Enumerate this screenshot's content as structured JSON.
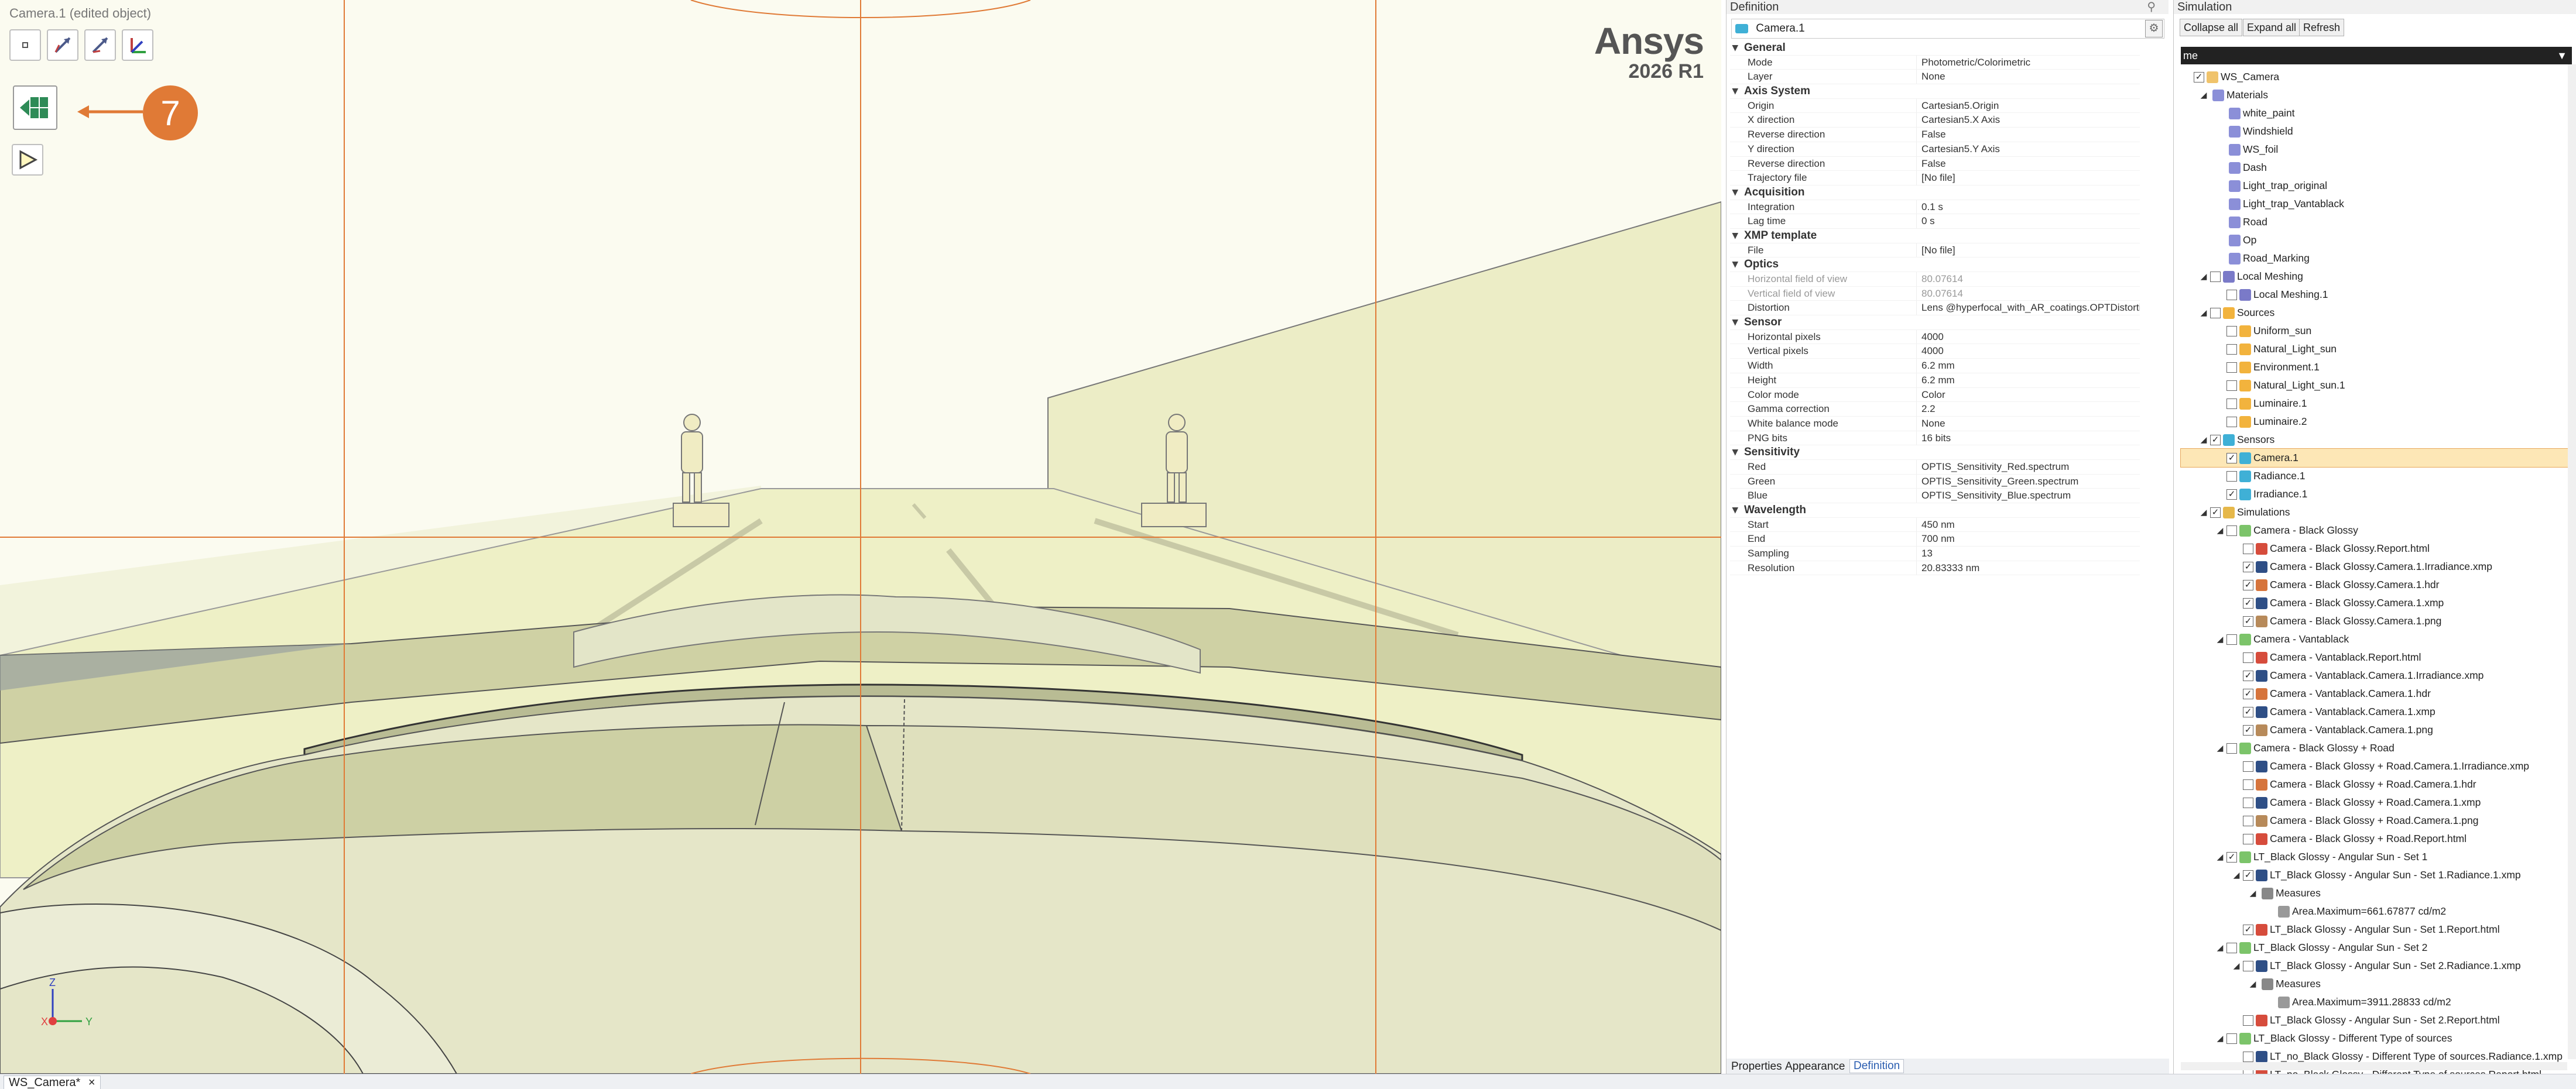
{
  "viewport": {
    "title": "Camera.1 (edited object)",
    "logo_name": "Ansys",
    "logo_version": "2026 R1",
    "callout_number": "7",
    "axis_labels": {
      "z": "Z",
      "x": "X",
      "y": "Y"
    }
  },
  "toolbar_icons": [
    "origin-point-icon",
    "axis-arrow-icon",
    "axis-arrow-2-icon",
    "axis-system-icon",
    "camera-preview-icon",
    "run-play-icon"
  ],
  "bottom_tab": "WS_Camera*",
  "definition": {
    "header": "Definition",
    "object_name": "Camera.1",
    "categories": [
      {
        "name": "General",
        "rows": [
          {
            "n": "Mode",
            "v": "Photometric/Colorimetric"
          },
          {
            "n": "Layer",
            "v": "None"
          }
        ]
      },
      {
        "name": "Axis System",
        "rows": [
          {
            "n": "Origin",
            "v": "Cartesian5.Origin"
          },
          {
            "n": "X direction",
            "v": "Cartesian5.X Axis"
          },
          {
            "n": "Reverse direction",
            "v": "False"
          },
          {
            "n": "Y direction",
            "v": "Cartesian5.Y Axis"
          },
          {
            "n": "Reverse direction",
            "v": "False"
          },
          {
            "n": "Trajectory file",
            "v": "[No file]"
          }
        ]
      },
      {
        "name": "Acquisition",
        "rows": [
          {
            "n": "Integration",
            "v": "0.1 s"
          },
          {
            "n": "Lag time",
            "v": "0 s"
          }
        ]
      },
      {
        "name": "XMP template",
        "rows": [
          {
            "n": "File",
            "v": "[No file]"
          }
        ]
      },
      {
        "name": "Optics",
        "rows": [
          {
            "n": "Horizontal field of view",
            "v": "80.07614",
            "ro": true
          },
          {
            "n": "Vertical field of view",
            "v": "80.07614",
            "ro": true
          },
          {
            "n": "Distortion",
            "v": "Lens @hyperfocal_with_AR_coatings.OPTDistortion"
          }
        ]
      },
      {
        "name": "Sensor",
        "rows": [
          {
            "n": "Horizontal pixels",
            "v": "4000"
          },
          {
            "n": "Vertical pixels",
            "v": "4000"
          },
          {
            "n": "Width",
            "v": "6.2 mm"
          },
          {
            "n": "Height",
            "v": "6.2 mm"
          },
          {
            "n": "Color mode",
            "v": "Color"
          },
          {
            "n": "Gamma correction",
            "v": "2.2"
          },
          {
            "n": "White balance mode",
            "v": "None"
          },
          {
            "n": "PNG bits",
            "v": "16 bits"
          }
        ]
      },
      {
        "name": "Sensitivity",
        "rows": [
          {
            "n": "Red",
            "v": "OPTIS_Sensitivity_Red.spectrum"
          },
          {
            "n": "Green",
            "v": "OPTIS_Sensitivity_Green.spectrum"
          },
          {
            "n": "Blue",
            "v": "OPTIS_Sensitivity_Blue.spectrum"
          }
        ]
      },
      {
        "name": "Wavelength",
        "rows": [
          {
            "n": "Start",
            "v": "450 nm"
          },
          {
            "n": "End",
            "v": "700 nm"
          },
          {
            "n": "Sampling",
            "v": "13"
          },
          {
            "n": "Resolution",
            "v": "20.83333 nm"
          }
        ]
      }
    ],
    "bottom_tabs": [
      "Properties",
      "Appearance",
      "Definition"
    ]
  },
  "simulation": {
    "header": "Simulation",
    "buttons": [
      "Collapse all",
      "Expand all",
      "Refresh"
    ],
    "column_header": "me",
    "tree": [
      {
        "d": 0,
        "t": "WS_Camera",
        "tog": "",
        "cb": "checked",
        "ic": "#f0c36b"
      },
      {
        "d": 1,
        "t": "Materials",
        "tog": "◢",
        "cb": "none",
        "ic": "#8b8fd8"
      },
      {
        "d": 2,
        "t": "white_paint",
        "tog": "",
        "cb": "none",
        "ic": "#8b8fd8"
      },
      {
        "d": 2,
        "t": "Windshield",
        "tog": "",
        "cb": "none",
        "ic": "#8b8fd8"
      },
      {
        "d": 2,
        "t": "WS_foil",
        "tog": "",
        "cb": "none",
        "ic": "#8b8fd8"
      },
      {
        "d": 2,
        "t": "Dash",
        "tog": "",
        "cb": "none",
        "ic": "#8b8fd8"
      },
      {
        "d": 2,
        "t": "Light_trap_original",
        "tog": "",
        "cb": "none",
        "ic": "#8b8fd8"
      },
      {
        "d": 2,
        "t": "Light_trap_Vantablack",
        "tog": "",
        "cb": "none",
        "ic": "#8b8fd8"
      },
      {
        "d": 2,
        "t": "Road",
        "tog": "",
        "cb": "none",
        "ic": "#8b8fd8"
      },
      {
        "d": 2,
        "t": "Op",
        "tog": "",
        "cb": "none",
        "ic": "#8b8fd8"
      },
      {
        "d": 2,
        "t": "Road_Marking",
        "tog": "",
        "cb": "none",
        "ic": "#8b8fd8"
      },
      {
        "d": 1,
        "t": "Local Meshing",
        "tog": "◢",
        "cb": "empty",
        "ic": "#7a7ac8"
      },
      {
        "d": 2,
        "t": "Local Meshing.1",
        "tog": "",
        "cb": "empty",
        "ic": "#7a7ac8"
      },
      {
        "d": 1,
        "t": "Sources",
        "tog": "◢",
        "cb": "empty",
        "ic": "#f2b33d"
      },
      {
        "d": 2,
        "t": "Uniform_sun",
        "tog": "",
        "cb": "empty",
        "ic": "#f2b33d"
      },
      {
        "d": 2,
        "t": "Natural_Light_sun",
        "tog": "",
        "cb": "empty",
        "ic": "#f2b33d"
      },
      {
        "d": 2,
        "t": "Environment.1",
        "tog": "",
        "cb": "empty",
        "ic": "#f2b33d"
      },
      {
        "d": 2,
        "t": "Natural_Light_sun.1",
        "tog": "",
        "cb": "empty",
        "ic": "#f2b33d"
      },
      {
        "d": 2,
        "t": "Luminaire.1",
        "tog": "",
        "cb": "empty",
        "ic": "#f2b33d"
      },
      {
        "d": 2,
        "t": "Luminaire.2",
        "tog": "",
        "cb": "empty",
        "ic": "#f2b33d"
      },
      {
        "d": 1,
        "t": "Sensors",
        "tog": "◢",
        "cb": "checked",
        "ic": "#3fb0d6"
      },
      {
        "d": 2,
        "t": "Camera.1",
        "tog": "",
        "cb": "checked",
        "ic": "#3fb0d6",
        "sel": true
      },
      {
        "d": 2,
        "t": "Radiance.1",
        "tog": "",
        "cb": "empty",
        "ic": "#3fb0d6"
      },
      {
        "d": 2,
        "t": "Irradiance.1",
        "tog": "",
        "cb": "checked",
        "ic": "#3fb0d6"
      },
      {
        "d": 1,
        "t": "Simulations",
        "tog": "◢",
        "cb": "checked",
        "ic": "#e6b84a"
      },
      {
        "d": 2,
        "t": "Camera -  Black Glossy",
        "tog": "◢",
        "cb": "empty",
        "ic": "#7cc46a"
      },
      {
        "d": 3,
        "t": "Camera -  Black Glossy.Report.html",
        "tog": "",
        "cb": "empty",
        "ic": "#d64c3c"
      },
      {
        "d": 3,
        "t": "Camera -  Black Glossy.Camera.1.Irradiance.xmp",
        "tog": "",
        "cb": "checked",
        "ic": "#2f4f86"
      },
      {
        "d": 3,
        "t": "Camera -  Black Glossy.Camera.1.hdr",
        "tog": "",
        "cb": "checked",
        "ic": "#d6743c"
      },
      {
        "d": 3,
        "t": "Camera -  Black Glossy.Camera.1.xmp",
        "tog": "",
        "cb": "checked",
        "ic": "#2f4f86"
      },
      {
        "d": 3,
        "t": "Camera -  Black Glossy.Camera.1.png",
        "tog": "",
        "cb": "checked",
        "ic": "#b78a5a"
      },
      {
        "d": 2,
        "t": "Camera - Vantablack",
        "tog": "◢",
        "cb": "empty",
        "ic": "#7cc46a"
      },
      {
        "d": 3,
        "t": "Camera - Vantablack.Report.html",
        "tog": "",
        "cb": "empty",
        "ic": "#d64c3c"
      },
      {
        "d": 3,
        "t": "Camera - Vantablack.Camera.1.Irradiance.xmp",
        "tog": "",
        "cb": "checked",
        "ic": "#2f4f86"
      },
      {
        "d": 3,
        "t": "Camera - Vantablack.Camera.1.hdr",
        "tog": "",
        "cb": "checked",
        "ic": "#d6743c"
      },
      {
        "d": 3,
        "t": "Camera - Vantablack.Camera.1.xmp",
        "tog": "",
        "cb": "checked",
        "ic": "#2f4f86"
      },
      {
        "d": 3,
        "t": "Camera - Vantablack.Camera.1.png",
        "tog": "",
        "cb": "checked",
        "ic": "#b78a5a"
      },
      {
        "d": 2,
        "t": "Camera - Black Glossy + Road",
        "tog": "◢",
        "cb": "empty",
        "ic": "#7cc46a"
      },
      {
        "d": 3,
        "t": "Camera - Black Glossy + Road.Camera.1.Irradiance.xmp",
        "tog": "",
        "cb": "empty",
        "ic": "#2f4f86"
      },
      {
        "d": 3,
        "t": "Camera - Black Glossy + Road.Camera.1.hdr",
        "tog": "",
        "cb": "empty",
        "ic": "#d6743c"
      },
      {
        "d": 3,
        "t": "Camera - Black Glossy + Road.Camera.1.xmp",
        "tog": "",
        "cb": "empty",
        "ic": "#2f4f86"
      },
      {
        "d": 3,
        "t": "Camera - Black Glossy + Road.Camera.1.png",
        "tog": "",
        "cb": "empty",
        "ic": "#b78a5a"
      },
      {
        "d": 3,
        "t": "Camera - Black Glossy + Road.Report.html",
        "tog": "",
        "cb": "empty",
        "ic": "#d64c3c"
      },
      {
        "d": 2,
        "t": "LT_Black Glossy - Angular Sun - Set 1",
        "tog": "◢",
        "cb": "checked",
        "ic": "#7cc46a"
      },
      {
        "d": 3,
        "t": "LT_Black Glossy - Angular Sun - Set 1.Radiance.1.xmp",
        "tog": "◢",
        "cb": "checked",
        "ic": "#2f4f86"
      },
      {
        "d": 4,
        "t": "Measures",
        "tog": "◢",
        "cb": "none",
        "ic": "#888888"
      },
      {
        "d": 5,
        "t": "Area.Maximum=661.67877 cd/m2",
        "tog": "",
        "cb": "none",
        "ic": "#999999"
      },
      {
        "d": 3,
        "t": "LT_Black Glossy - Angular Sun - Set 1.Report.html",
        "tog": "",
        "cb": "checked",
        "ic": "#d64c3c"
      },
      {
        "d": 2,
        "t": "LT_Black Glossy - Angular Sun - Set 2",
        "tog": "◢",
        "cb": "empty",
        "ic": "#7cc46a"
      },
      {
        "d": 3,
        "t": "LT_Black Glossy - Angular Sun - Set 2.Radiance.1.xmp",
        "tog": "◢",
        "cb": "empty",
        "ic": "#2f4f86"
      },
      {
        "d": 4,
        "t": "Measures",
        "tog": "◢",
        "cb": "none",
        "ic": "#888888"
      },
      {
        "d": 5,
        "t": "Area.Maximum=3911.28833 cd/m2",
        "tog": "",
        "cb": "none",
        "ic": "#999999"
      },
      {
        "d": 3,
        "t": "LT_Black Glossy - Angular Sun - Set 2.Report.html",
        "tog": "",
        "cb": "empty",
        "ic": "#d64c3c"
      },
      {
        "d": 2,
        "t": "LT_Black Glossy - Different Type of sources",
        "tog": "◢",
        "cb": "empty",
        "ic": "#7cc46a"
      },
      {
        "d": 3,
        "t": "LT_no_Black Glossy - Different Type of sources.Radiance.1.xmp",
        "tog": "",
        "cb": "empty",
        "ic": "#2f4f86"
      },
      {
        "d": 3,
        "t": "LT_no_Black Glossy - Different Type of sources.Report.html",
        "tog": "",
        "cb": "empty",
        "ic": "#d64c3c"
      }
    ]
  },
  "colors": {
    "accent": "#e07a36",
    "selection": "#fde7b6",
    "viewport_bg": "#fbfbf0",
    "grid_line": "#e07a36"
  }
}
